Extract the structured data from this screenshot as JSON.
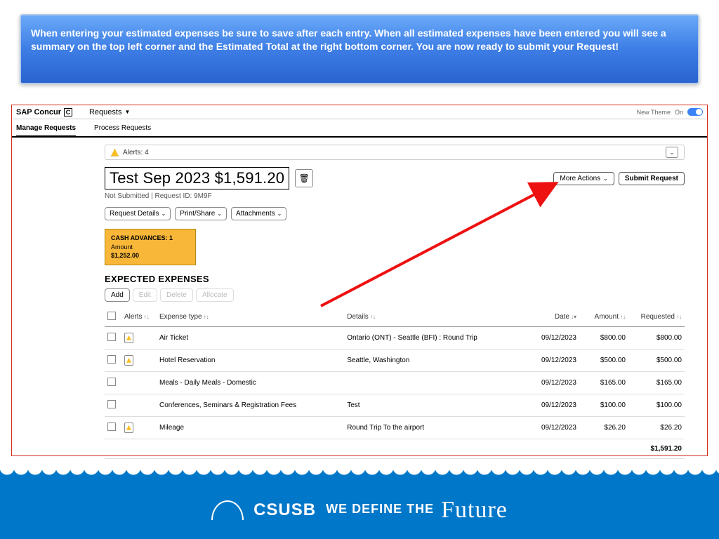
{
  "banner": {
    "text": "When entering your estimated expenses be sure to save after each entry. When all estimated expenses have been entered you will see a summary on the top left corner and the Estimated Total at the right bottom corner. You are now ready to submit your Request!"
  },
  "header": {
    "brand": "SAP Concur",
    "brand_glyph": "C",
    "menu1": "Requests",
    "new_theme_label": "New Theme",
    "toggle_label": "On"
  },
  "tabs": {
    "manage": "Manage Requests",
    "process": "Process Requests"
  },
  "alerts": {
    "label": "Alerts: 4"
  },
  "request": {
    "title": "Test Sep 2023 $1,591.20",
    "status_line": "Not Submitted   |   Request ID: 9M9F",
    "more_actions": "More Actions",
    "submit": "Submit Request",
    "details_btn": "Request Details",
    "print_btn": "Print/Share",
    "attach_btn": "Attachments"
  },
  "cash": {
    "heading": "CASH ADVANCES: 1",
    "amount_label": "Amount",
    "amount": "$1,252.00"
  },
  "section": {
    "title": "EXPECTED EXPENSES"
  },
  "toolbar": {
    "add": "Add",
    "edit": "Edit",
    "delete": "Delete",
    "allocate": "Allocate"
  },
  "columns": {
    "alerts": "Alerts",
    "type": "Expense type",
    "details": "Details",
    "date": "Date",
    "amount": "Amount",
    "requested": "Requested"
  },
  "rows": [
    {
      "has_alert": true,
      "type": "Air Ticket",
      "details": "Ontario (ONT) - Seattle (BFI) : Round Trip",
      "date": "09/12/2023",
      "amount": "$800.00",
      "requested": "$800.00"
    },
    {
      "has_alert": true,
      "type": "Hotel Reservation",
      "details": "Seattle, Washington",
      "date": "09/12/2023",
      "amount": "$500.00",
      "requested": "$500.00"
    },
    {
      "has_alert": false,
      "type": "Meals - Daily Meals - Domestic",
      "details": "",
      "date": "09/12/2023",
      "amount": "$165.00",
      "requested": "$165.00"
    },
    {
      "has_alert": false,
      "type": "Conferences, Seminars & Registration Fees",
      "details": "Test",
      "date": "09/12/2023",
      "amount": "$100.00",
      "requested": "$100.00"
    },
    {
      "has_alert": true,
      "type": "Mileage",
      "details": "Round Trip To the airport",
      "date": "09/12/2023",
      "amount": "$26.20",
      "requested": "$26.20"
    }
  ],
  "total": "$1,591.20",
  "footer": {
    "brand": "CSUSB",
    "tag_a": "WE DEFINE THE",
    "tag_b": "Future"
  }
}
